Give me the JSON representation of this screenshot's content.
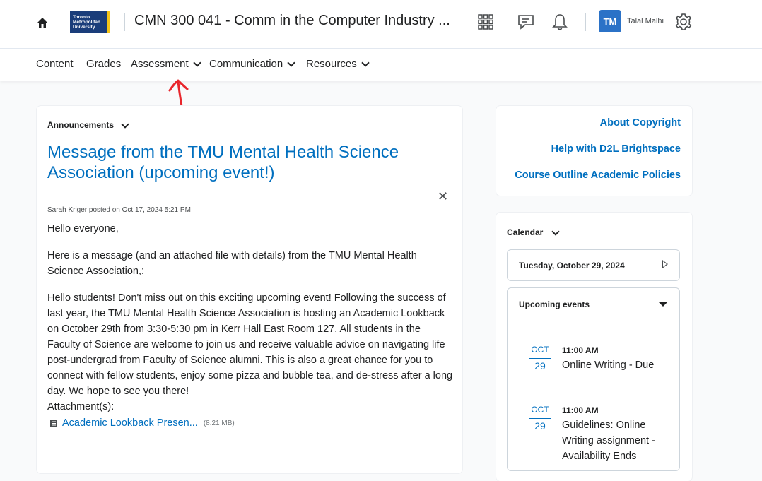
{
  "header": {
    "logo_lines": [
      "Toronto",
      "Metropolitan",
      "University"
    ],
    "course_title": "CMN 300 041 - Comm in the Computer Industry ...",
    "user_initials": "TM",
    "user_name": "Talal Malhi"
  },
  "nav": {
    "items": [
      {
        "label": "Content"
      },
      {
        "label": "Grades"
      },
      {
        "label": "Assessment"
      },
      {
        "label": "Communication"
      },
      {
        "label": "Resources"
      }
    ]
  },
  "announcement": {
    "widget_title": "Announcements",
    "headline": "Message from the TMU Mental Health Science Association (upcoming event!)",
    "byline": "Sarah Kriger posted on Oct 17, 2024 5:21 PM",
    "greeting": "Hello everyone,",
    "intro": "Here is a message (and an attached file with details) from the TMU Mental Health Science Association,:",
    "body": "Hello students! Don't miss out on this exciting upcoming event! Following the success of last year, the TMU Mental Health Science Association is hosting an Academic Lookback on October 29th from 3:30-5:30 pm in Kerr Hall East Room 127. All students in the Faculty of Science are welcome to join us and receive valuable advice on navigating life post-undergrad from Faculty of Science alumni. This is also a great chance for you to connect with fellow students, enjoy some pizza and bubble tea, and de-stress after a long day. We hope to see you there!",
    "attachments_label": "Attachment(s):",
    "attachment_name": "Academic Lookback Presen...",
    "attachment_size": "(8.21 MB)"
  },
  "links": {
    "items": [
      "About Copyright",
      "Help with D2L Brightspace",
      "Course Outline Academic Policies"
    ]
  },
  "calendar": {
    "widget_title": "Calendar",
    "date": "Tuesday, October 29, 2024",
    "upcoming_title": "Upcoming events",
    "events": [
      {
        "month": "OCT",
        "day": "29",
        "time": "11:00 AM",
        "title": "Online Writing - Due"
      },
      {
        "month": "OCT",
        "day": "29",
        "time": "11:00 AM",
        "title": "Guidelines: Online Writing assignment - Availability Ends"
      }
    ]
  },
  "colors": {
    "link_blue": "#006fbf",
    "avatar_blue": "#2b72c7",
    "annotation_red": "#e8262c",
    "tmu_navy": "#1a3d7a",
    "tmu_gold": "#f5c518"
  }
}
